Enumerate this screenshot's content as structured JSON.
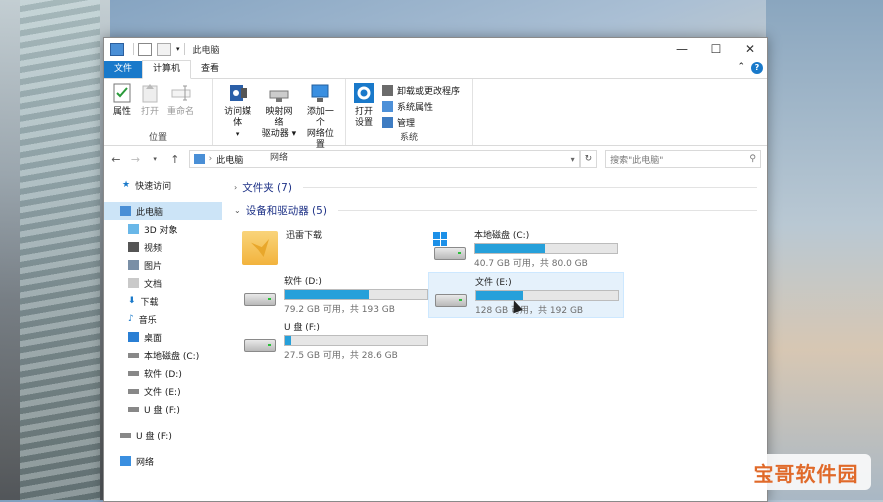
{
  "window": {
    "title": "此电脑"
  },
  "tabs": {
    "file": "文件",
    "computer": "计算机",
    "view": "查看"
  },
  "ribbon": {
    "location": {
      "label": "位置",
      "properties": "属性",
      "open": "打开",
      "rename": "重命名"
    },
    "network": {
      "label": "网络",
      "media_line1": "访问媒体",
      "map_line1": "映射网络",
      "map_line2": "驱动器",
      "add_line1": "添加一个",
      "add_line2": "网络位置"
    },
    "system": {
      "label": "系统",
      "open_settings_line1": "打开",
      "open_settings_line2": "设置",
      "uninstall": "卸载或更改程序",
      "sys_props": "系统属性",
      "manage": "管理"
    }
  },
  "address": {
    "path": "此电脑",
    "search_placeholder": "搜索\"此电脑\""
  },
  "nav": {
    "quick_access": "快速访问",
    "this_pc": "此电脑",
    "objects3d": "3D 对象",
    "videos": "视频",
    "pictures": "图片",
    "documents": "文档",
    "downloads": "下载",
    "music": "音乐",
    "desktop": "桌面",
    "drive_c": "本地磁盘 (C:)",
    "drive_d": "软件 (D:)",
    "drive_e": "文件 (E:)",
    "drive_f": "U 盘 (F:)",
    "drive_f2": "U 盘 (F:)",
    "network": "网络"
  },
  "sections": {
    "folders": "文件夹 (7)",
    "devices": "设备和驱动器 (5)"
  },
  "drives": {
    "thunder": {
      "name": "迅雷下载"
    },
    "c": {
      "name": "本地磁盘 (C:)",
      "size": "40.7 GB 可用，共 80.0 GB",
      "used_fraction": 0.49
    },
    "d": {
      "name": "软件 (D:)",
      "size": "79.2 GB 可用，共 193 GB",
      "used_fraction": 0.59
    },
    "e": {
      "name": "文件 (E:)",
      "size": "128 GB 可用，共 192 GB",
      "used_fraction": 0.33
    },
    "f": {
      "name": "U 盘 (F:)",
      "size": "27.5 GB 可用，共 28.6 GB",
      "used_fraction": 0.04
    }
  },
  "colors": {
    "accent": "#1979ca",
    "bar_fill": "#26a0da",
    "section_title": "#1e3287"
  },
  "watermark": "宝哥软件园"
}
